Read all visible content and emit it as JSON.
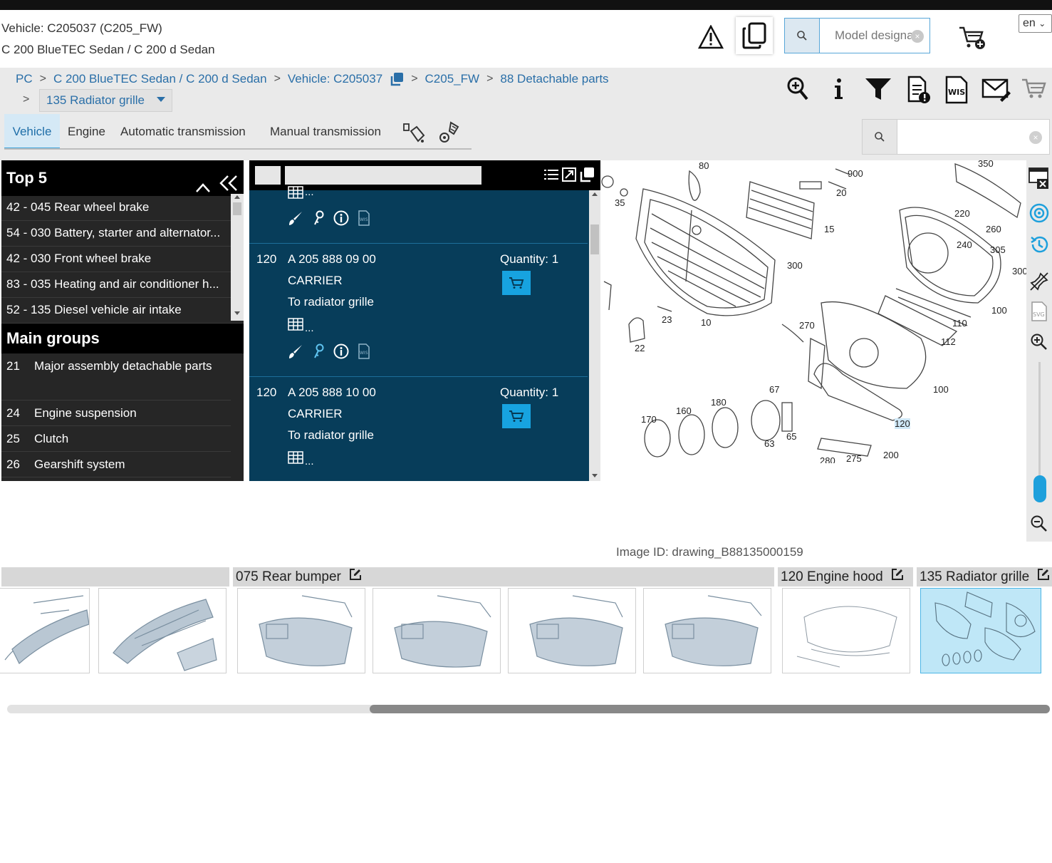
{
  "header": {
    "vehicle_line1": "Vehicle: C205037 (C205_FW)",
    "vehicle_line2": "C 200 BlueTEC Sedan / C 200 d Sedan",
    "search_placeholder": "Model designation",
    "search_clear": "×",
    "language": "en",
    "icons": [
      "warning-icon",
      "copy-icon",
      "search-icon",
      "cart-add-icon"
    ]
  },
  "breadcrumb": {
    "items": [
      "PC",
      "C 200 BlueTEC Sedan / C 200 d Sedan",
      "Vehicle: C205037",
      "C205_FW",
      "88 Detachable parts"
    ],
    "separator": ">",
    "current": "135 Radiator grille"
  },
  "toolbar": {
    "icons": [
      "zoom-in-icon",
      "info-icon",
      "filter-icon",
      "document-alert-icon",
      "wis-icon",
      "mail-icon",
      "cart-icon"
    ]
  },
  "tabs": {
    "items": [
      "Vehicle",
      "Engine",
      "Automatic transmission",
      "Manual transmission"
    ],
    "active": "Vehicle",
    "search_clear": "×"
  },
  "top5": {
    "title": "Top 5",
    "items": [
      "42 - 045 Rear wheel brake",
      "54 - 030 Battery, starter and alternator...",
      "42 - 030 Front wheel brake",
      "83 - 035 Heating and air conditioner h...",
      "52 - 135 Diesel vehicle air intake"
    ]
  },
  "main_groups": {
    "title": "Main groups",
    "items": [
      {
        "num": "21",
        "label": "Major assembly detachable parts"
      },
      {
        "num": "24",
        "label": "Engine suspension"
      },
      {
        "num": "25",
        "label": "Clutch"
      },
      {
        "num": "26",
        "label": "Gearshift system"
      }
    ]
  },
  "parts": {
    "grid_label": "...",
    "wis_label": "WIS",
    "items": [
      {
        "pos": "120",
        "number": "A 205 888 09 00",
        "name": "CARRIER",
        "desc": "To radiator grille",
        "qty": "Quantity: 1"
      },
      {
        "pos": "120",
        "number": "A 205 888 10 00",
        "name": "CARRIER",
        "desc": "To radiator grille",
        "qty": "Quantity: 1"
      }
    ]
  },
  "drawing": {
    "callouts": [
      "80",
      "900",
      "20",
      "350",
      "35",
      "15",
      "220",
      "260",
      "240",
      "305",
      "300",
      "300",
      "100",
      "23",
      "10",
      "270",
      "110",
      "112",
      "22",
      "67",
      "100",
      "180",
      "160",
      "170",
      "65",
      "63",
      "120",
      "275",
      "200",
      "280"
    ],
    "highlighted": "120",
    "image_id": "Image ID: drawing_B88135000159",
    "rail_icons": [
      "close-view-icon",
      "target-icon",
      "history-icon",
      "pin-icon",
      "svg-icon",
      "zoom-in-icon",
      "zoom-out-icon"
    ],
    "zoom_level": 0.15
  },
  "thumbnails": {
    "groups": [
      {
        "label": ""
      },
      {
        "label": "075 Rear bumper"
      },
      {
        "label": "120 Engine hood"
      },
      {
        "label": "135 Radiator grille"
      }
    ],
    "selected": "135 Radiator grille",
    "scroll": {
      "visible_fraction": 0.65,
      "offset_fraction": 0.35
    }
  },
  "colors": {
    "accent": "#17a3e0",
    "link": "#2a6fa8",
    "parts_bg": "#073d5a",
    "panel_bg": "#262626"
  }
}
